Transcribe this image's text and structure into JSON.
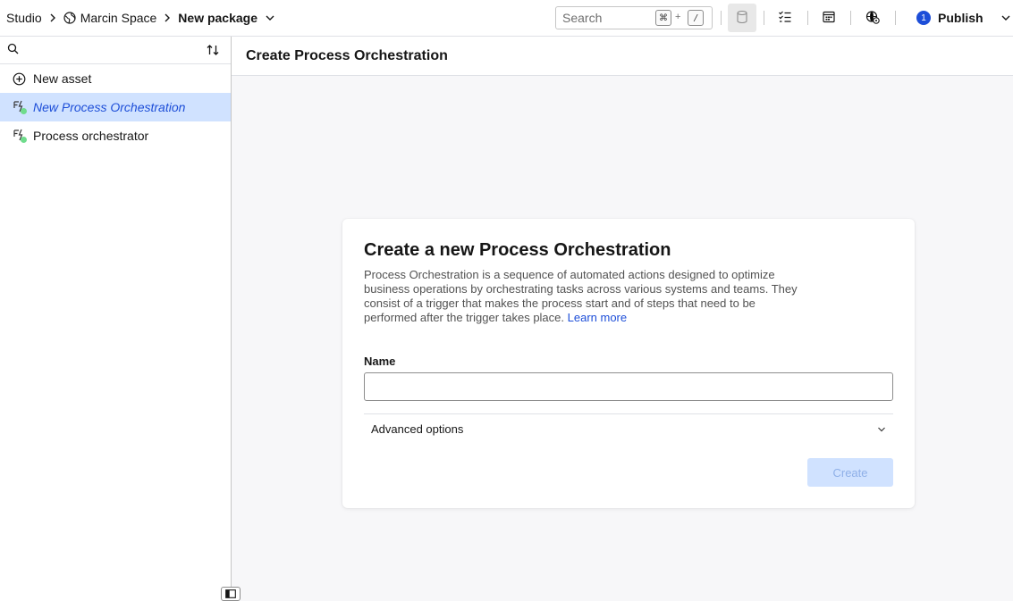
{
  "breadcrumb": {
    "items": [
      {
        "label": "Studio"
      },
      {
        "label": "Marcin Space"
      },
      {
        "label": "New package"
      }
    ]
  },
  "search": {
    "placeholder": "Search",
    "shortcut_key1": "⌘",
    "shortcut_plus": "+",
    "shortcut_key2": "/"
  },
  "publish": {
    "badge": "1",
    "label": "Publish"
  },
  "sidebar": {
    "search_placeholder": "",
    "items": [
      {
        "label": "New asset"
      },
      {
        "label": "New Process Orchestration",
        "selected": true
      },
      {
        "label": "Process orchestrator"
      }
    ]
  },
  "main": {
    "title": "Create Process Orchestration"
  },
  "card": {
    "title": "Create a new Process Orchestration",
    "description": "Process Orchestration is a sequence of automated actions designed to optimize business operations by orchestrating tasks across various systems and teams. They consist of a trigger that makes the process start and of steps that need to be performed after the trigger takes place.",
    "learn_more": "Learn more",
    "name_label": "Name",
    "name_value": "",
    "advanced_label": "Advanced options",
    "create_label": "Create"
  },
  "colors": {
    "accent": "#1d4ed8",
    "selected_bg": "#d0e2ff",
    "status_dot": "#6fdc8c"
  }
}
